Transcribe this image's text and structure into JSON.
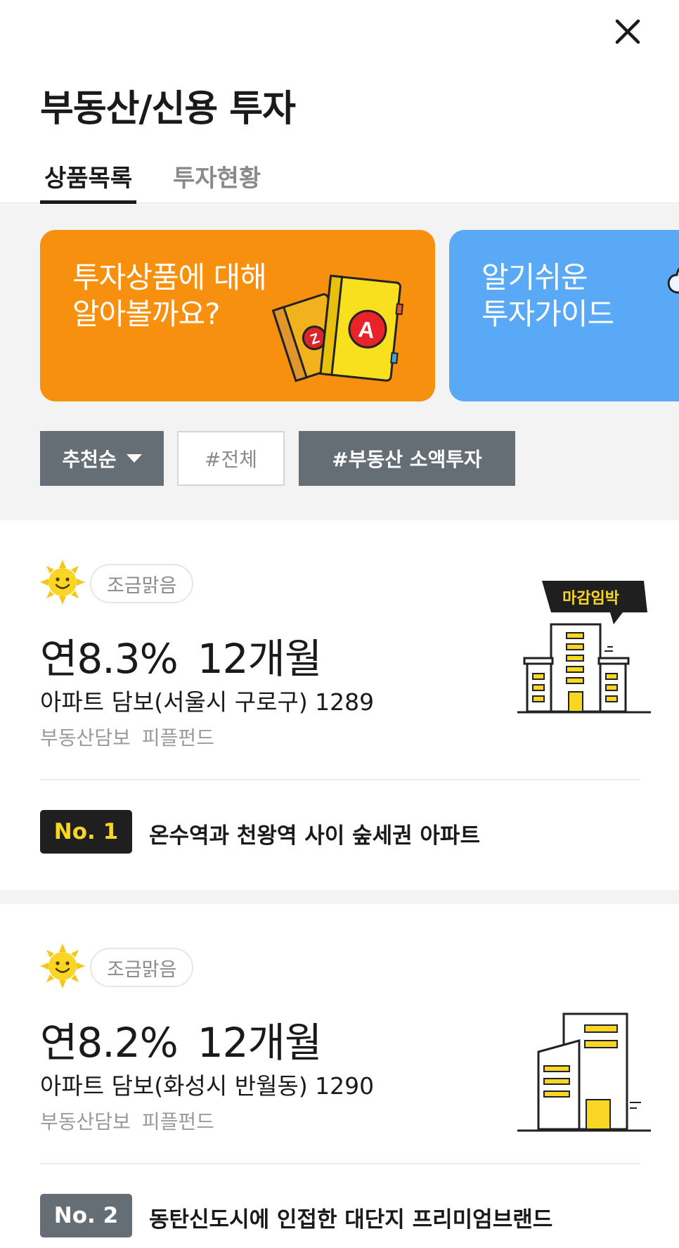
{
  "header": {
    "title": "부동산/신용 투자",
    "close_icon": "close-icon"
  },
  "tabs": [
    {
      "label": "상품목록",
      "active": true
    },
    {
      "label": "투자현황",
      "active": false
    }
  ],
  "banners": [
    {
      "line1": "투자상품에 대해",
      "line2": "알아볼까요?",
      "color": "#f7900f"
    },
    {
      "line1": "알기쉬운",
      "line2": "투자가이드",
      "color": "#5aa9f7"
    }
  ],
  "filters": {
    "sort_label": "추천순",
    "all_label": "#전체",
    "tag_label": "#부동산 소액투자"
  },
  "products": [
    {
      "weather": "조금맑음",
      "rate": "연8.3%",
      "term": "12개월",
      "name": "아파트 담보(서울시 구로구) 1289",
      "tags": [
        "부동산담보",
        "피플펀드"
      ],
      "badge_text": "마감임박",
      "rank": "No. 1",
      "highlight": "온수역과 천왕역 사이 숲세권 아파트"
    },
    {
      "weather": "조금맑음",
      "rate": "연8.2%",
      "term": "12개월",
      "name": "아파트 담보(화성시 반월동) 1290",
      "tags": [
        "부동산담보",
        "피플펀드"
      ],
      "rank": "No. 2",
      "highlight": "동탄신도시에 인접한 대단지 프리미엄브랜드"
    }
  ],
  "colors": {
    "accent_orange": "#f7900f",
    "accent_blue": "#5aa9f7",
    "brand_yellow": "#f9d624",
    "button_gray": "#656d75"
  }
}
